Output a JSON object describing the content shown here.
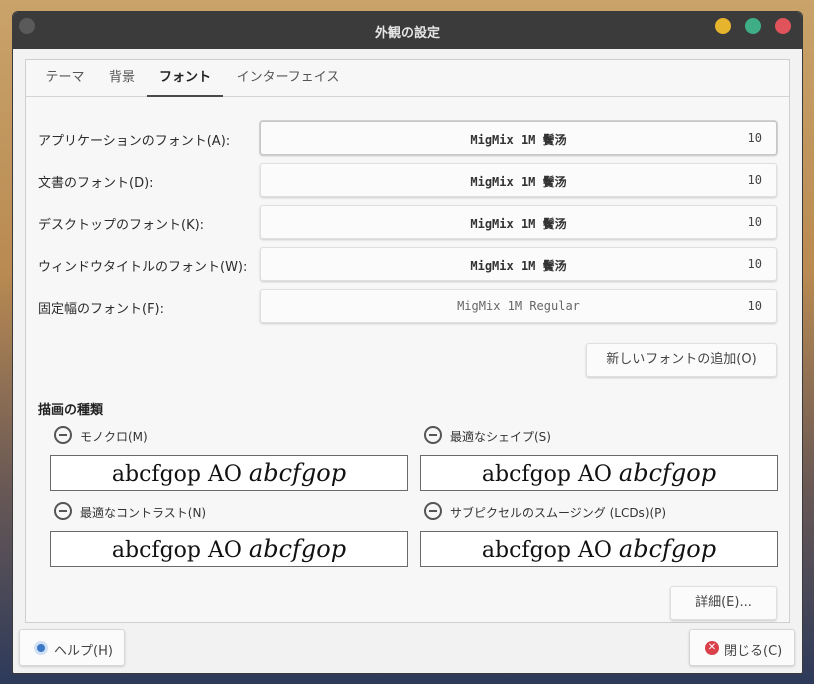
{
  "window": {
    "title": "外観の設定"
  },
  "tabs": [
    {
      "label": "テーマ"
    },
    {
      "label": "背景"
    },
    {
      "label": "フォント"
    },
    {
      "label": "インターフェイス"
    }
  ],
  "fonts": [
    {
      "label": "アプリケーションのフォント(A):",
      "font": "MigMix 1M 鬢汤",
      "size": "10"
    },
    {
      "label": "文書のフォント(D):",
      "font": "MigMix 1M 鬢汤",
      "size": "10"
    },
    {
      "label": "デスクトップのフォント(K):",
      "font": "MigMix 1M 鬢汤",
      "size": "10"
    },
    {
      "label": "ウィンドウタイトルのフォント(W):",
      "font": "MigMix 1M 鬢汤",
      "size": "10"
    },
    {
      "label": "固定幅のフォント(F):",
      "font": "MigMix 1M Regular",
      "size": "10"
    }
  ],
  "add_font_button": "新しいフォントの追加(O)",
  "rendering": {
    "title": "描画の種類",
    "options": [
      {
        "label": "モノクロ(M)",
        "preview_plain": "abcfgop AO",
        "preview_italic": "abcfgop"
      },
      {
        "label": "最適なシェイプ(S)",
        "preview_plain": "abcfgop AO",
        "preview_italic": "abcfgop"
      },
      {
        "label": "最適なコントラスト(N)",
        "preview_plain": "abcfgop AO",
        "preview_italic": "abcfgop"
      },
      {
        "label": "サブピクセルのスムージング (LCDs)(P)",
        "preview_plain": "abcfgop AO",
        "preview_italic": "abcfgop"
      }
    ]
  },
  "details_button": "詳細(E)...",
  "help_button": "ヘルプ(H)",
  "close_button": "閉じる(C)"
}
